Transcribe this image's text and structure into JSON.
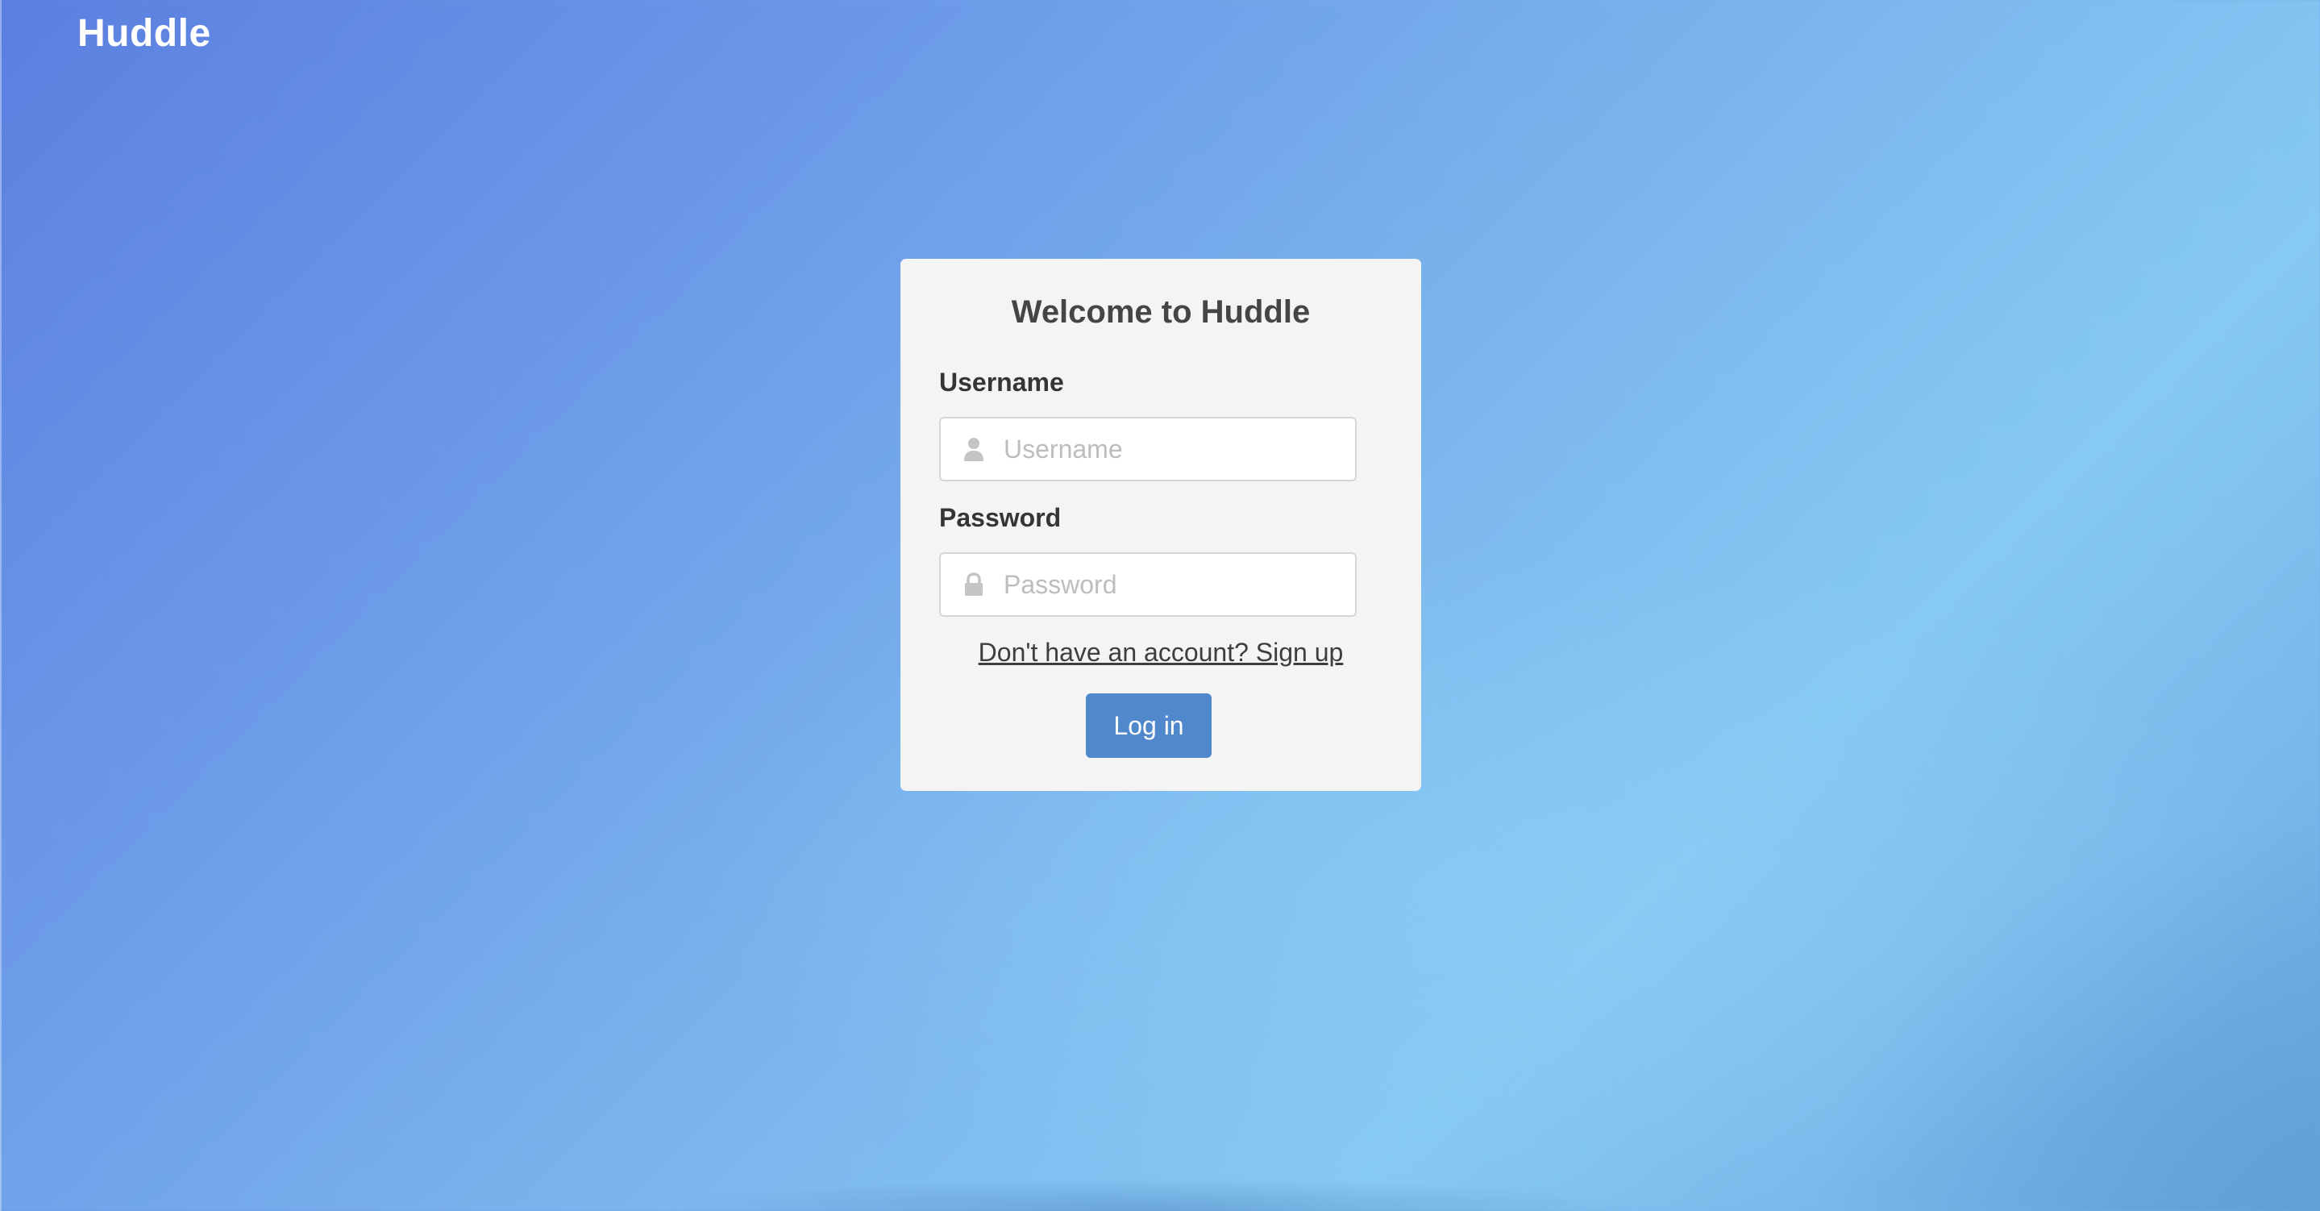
{
  "header": {
    "brand": "Huddle"
  },
  "login_card": {
    "title": "Welcome to Huddle",
    "username": {
      "label": "Username",
      "placeholder": "Username",
      "value": "",
      "icon": "user-icon"
    },
    "password": {
      "label": "Password",
      "placeholder": "Password",
      "value": "",
      "icon": "lock-icon"
    },
    "signup_link": "Don't have an account? Sign up",
    "login_button": "Log in"
  },
  "colors": {
    "background_gradient_start": "#5b7fe0",
    "background_gradient_end": "#86c9f3",
    "card_background": "#f4f4f4",
    "button_primary": "#4f88cb",
    "brand_text": "#ffffff"
  }
}
